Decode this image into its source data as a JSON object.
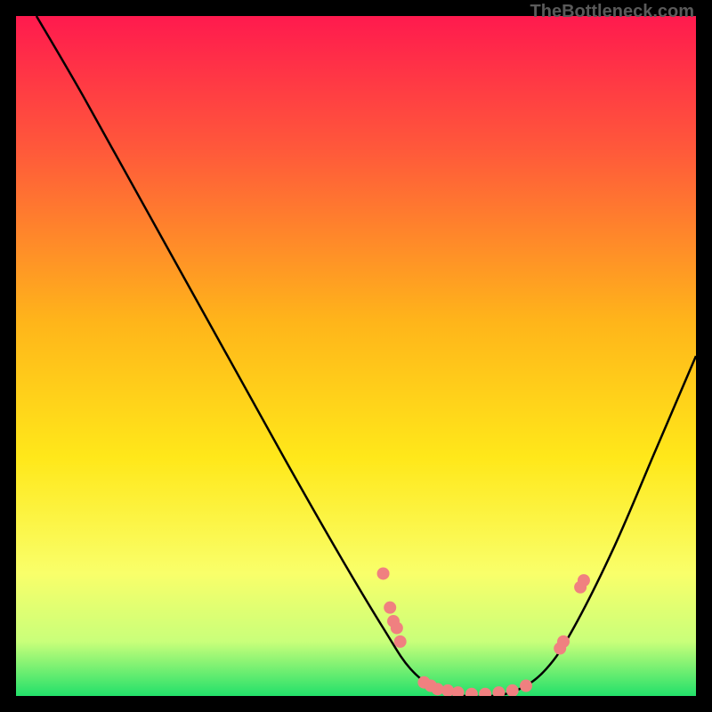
{
  "watermark": "TheBottleneck.com",
  "chart_data": {
    "type": "line",
    "title": "",
    "xlabel": "",
    "ylabel": "",
    "xlim": [
      0,
      100
    ],
    "ylim": [
      0,
      100
    ],
    "gradient_stops": [
      {
        "offset": 0,
        "color": "#ff1a4e"
      },
      {
        "offset": 20,
        "color": "#ff5a3a"
      },
      {
        "offset": 45,
        "color": "#ffb51a"
      },
      {
        "offset": 65,
        "color": "#ffe81a"
      },
      {
        "offset": 82,
        "color": "#f9ff6a"
      },
      {
        "offset": 92,
        "color": "#c9ff7a"
      },
      {
        "offset": 100,
        "color": "#22e06a"
      }
    ],
    "curve": [
      {
        "x": 3,
        "y": 100
      },
      {
        "x": 10,
        "y": 88
      },
      {
        "x": 20,
        "y": 70
      },
      {
        "x": 30,
        "y": 52
      },
      {
        "x": 40,
        "y": 34
      },
      {
        "x": 48,
        "y": 20
      },
      {
        "x": 54,
        "y": 10
      },
      {
        "x": 58,
        "y": 4
      },
      {
        "x": 62,
        "y": 1
      },
      {
        "x": 66,
        "y": 0
      },
      {
        "x": 70,
        "y": 0
      },
      {
        "x": 74,
        "y": 1
      },
      {
        "x": 78,
        "y": 4
      },
      {
        "x": 82,
        "y": 10
      },
      {
        "x": 88,
        "y": 22
      },
      {
        "x": 94,
        "y": 36
      },
      {
        "x": 100,
        "y": 50
      }
    ],
    "points": [
      {
        "x": 54,
        "y": 18
      },
      {
        "x": 55,
        "y": 13
      },
      {
        "x": 55.5,
        "y": 11
      },
      {
        "x": 56,
        "y": 10
      },
      {
        "x": 56.5,
        "y": 8
      },
      {
        "x": 60,
        "y": 2
      },
      {
        "x": 61,
        "y": 1.5
      },
      {
        "x": 62,
        "y": 1
      },
      {
        "x": 63.5,
        "y": 0.8
      },
      {
        "x": 65,
        "y": 0.5
      },
      {
        "x": 67,
        "y": 0.3
      },
      {
        "x": 69,
        "y": 0.3
      },
      {
        "x": 71,
        "y": 0.5
      },
      {
        "x": 73,
        "y": 0.8
      },
      {
        "x": 75,
        "y": 1.5
      },
      {
        "x": 80,
        "y": 7
      },
      {
        "x": 80.5,
        "y": 8
      },
      {
        "x": 83,
        "y": 16
      },
      {
        "x": 83.5,
        "y": 17
      }
    ],
    "point_color": "#f08080",
    "curve_color": "#000000"
  }
}
